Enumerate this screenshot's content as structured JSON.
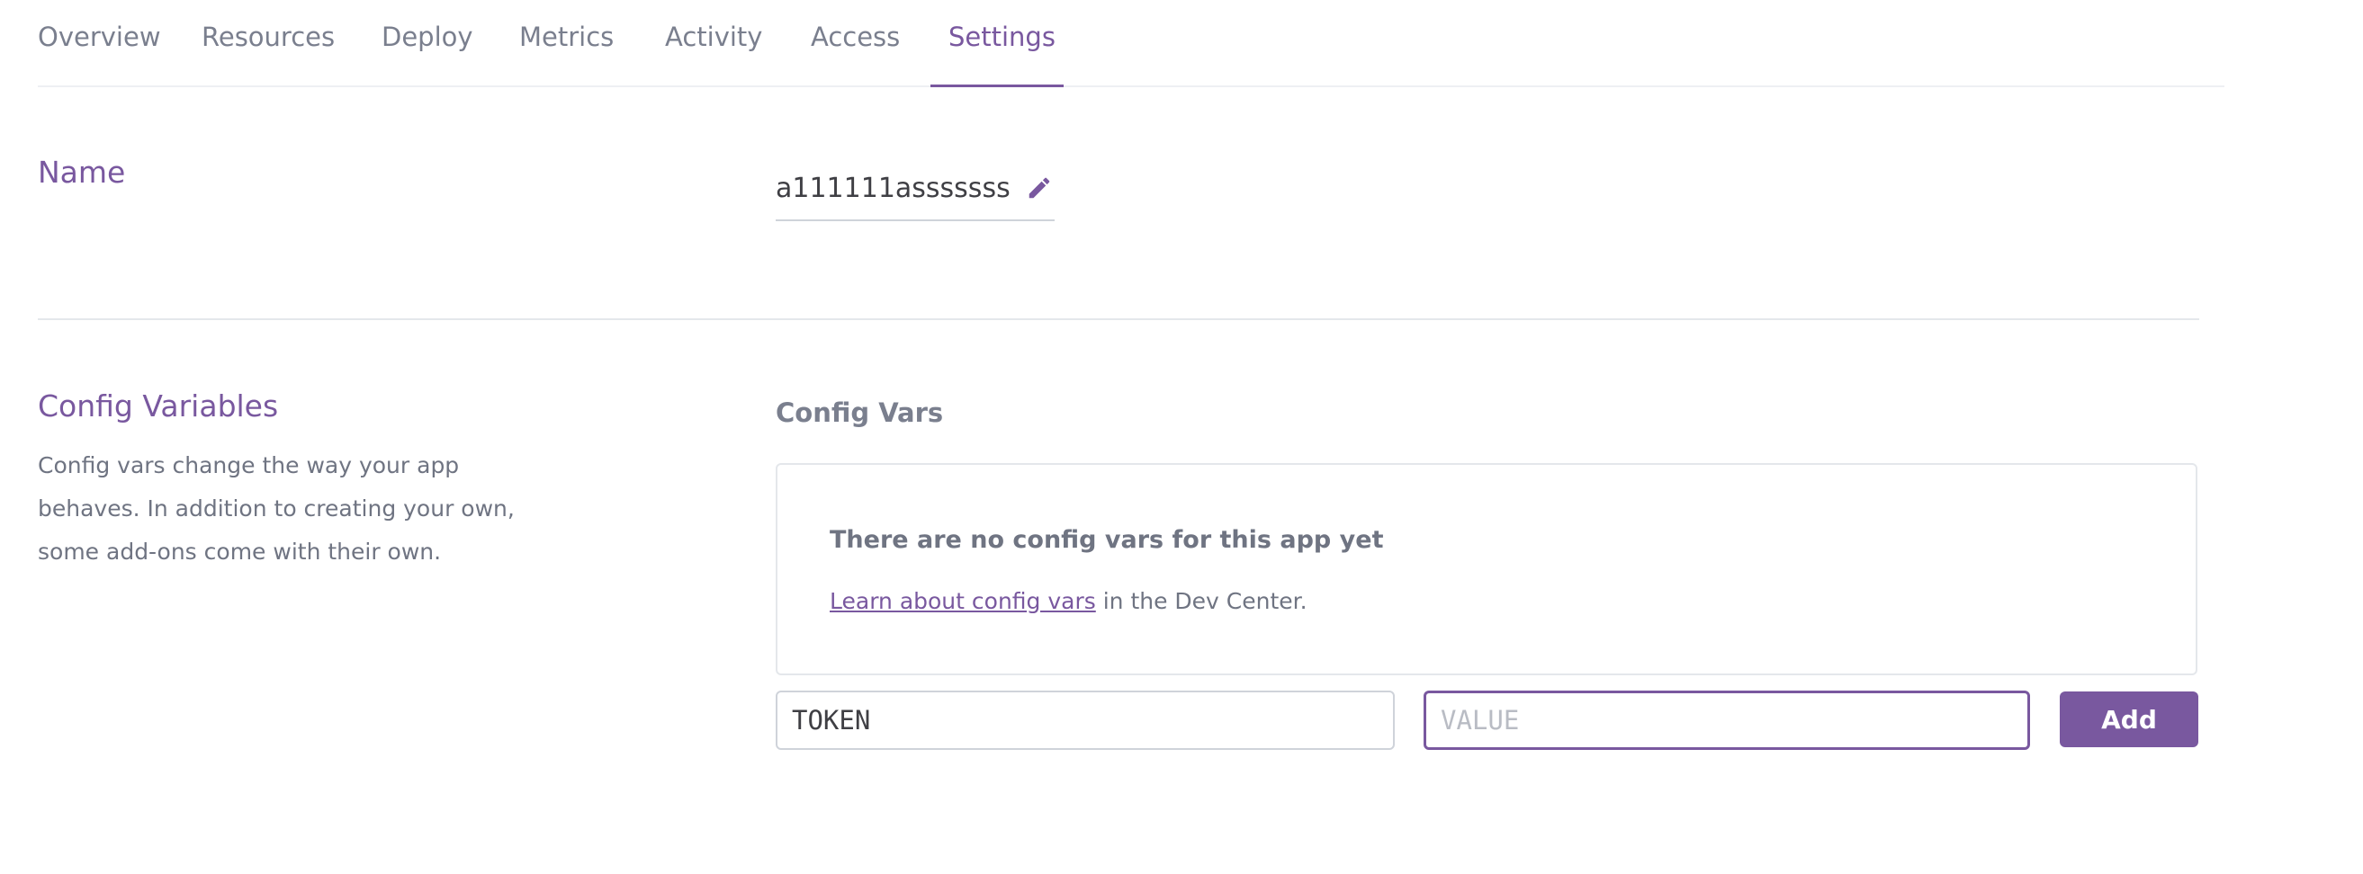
{
  "tabs": [
    {
      "label": "Overview",
      "active": false
    },
    {
      "label": "Resources",
      "active": false
    },
    {
      "label": "Deploy",
      "active": false
    },
    {
      "label": "Metrics",
      "active": false
    },
    {
      "label": "Activity",
      "active": false
    },
    {
      "label": "Access",
      "active": false
    },
    {
      "label": "Settings",
      "active": true
    }
  ],
  "name_section": {
    "title": "Name",
    "value": "a111111asssssss",
    "edit_icon": "pencil-icon"
  },
  "config_section": {
    "title": "Config Variables",
    "description": "Config vars change the way your app behaves. In addition to creating your own, some add-ons come with their own.",
    "subheading": "Config Vars",
    "empty_title": "There are no config vars for this app yet",
    "learn_link": "Learn about config vars",
    "learn_suffix": " in the Dev Center.",
    "key_value": "TOKEN",
    "value_placeholder": "VALUE",
    "add_label": "Add"
  },
  "colors": {
    "accent": "#79589f",
    "muted_text": "#7a7f8e",
    "border": "#cfd3da"
  }
}
